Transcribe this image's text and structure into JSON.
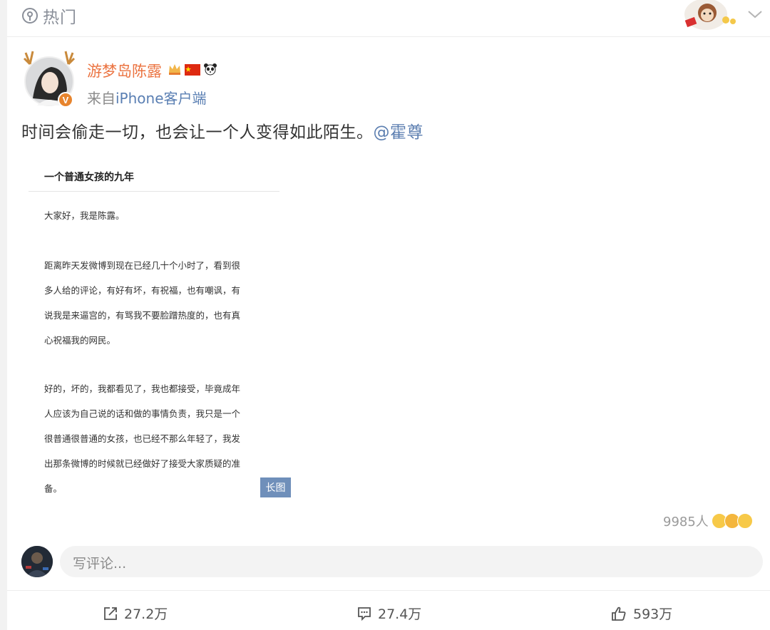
{
  "header": {
    "tab_label": "热门",
    "tab_icon": "location-pin-icon"
  },
  "post": {
    "author_name": "游梦岛陈露",
    "source_prefix": "来自",
    "source_device": "iPhone客户端",
    "text": "时间会偷走一切，也会让一个人变得如此陌生。",
    "mention": "@霍尊",
    "image": {
      "title": "一个普通女孩的九年",
      "lines": [
        "大家好，我是陈露。",
        "距离昨天发微博到现在已经几十个小时了，看到很",
        "多人给的评论，有好有坏，有祝福，也有嘲讽，有",
        "说我是来逼宫的，有骂我不要脸蹭热度的，也有真",
        "心祝福我的网民。",
        "好的，坏的，我都看见了，我也都接受，毕竟成年",
        "人应该为自己说的话和做的事情负责，我只是一个",
        "很普通很普通的女孩，也已经不那么年轻了，我发",
        "出那条微博的时候就已经做好了接受大家质疑的准",
        "备。"
      ],
      "tag": "长图"
    },
    "reactions_count": "9985人"
  },
  "comment": {
    "placeholder": "写评论..."
  },
  "actions": {
    "repost": "27.2万",
    "comments": "27.4万",
    "likes": "593万"
  },
  "colors": {
    "name": "#eb7340",
    "link": "#5b7eb0",
    "tag_bg": "#6f8fba"
  }
}
